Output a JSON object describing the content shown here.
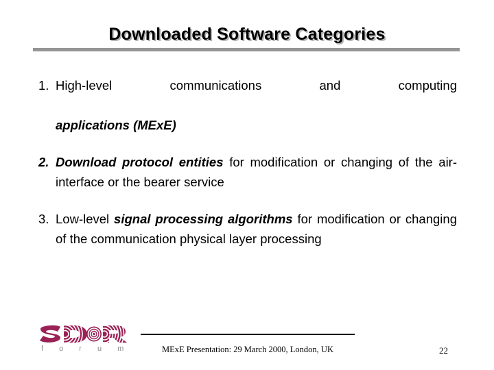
{
  "slide": {
    "title": "Downloaded Software Categories",
    "accent_rule_color": "#959595",
    "logo_color": "#9b2256",
    "text_color": "#000000",
    "background_color": "#ffffff"
  },
  "body": {
    "items": [
      {
        "number": "1.",
        "number_style": "regular",
        "line1_regular": "High-level communications and computing",
        "line2_bold_italic": "applications (MExE)"
      },
      {
        "number": "2.",
        "number_style": "bold-italic",
        "lead_bold_italic": "Download protocol entities",
        "rest_regular": " for modification or changing of the air-interface or the bearer service"
      },
      {
        "number": "3.",
        "number_style": "regular",
        "lead_regular": "Low-level ",
        "mid_bold_italic": "signal processing algorithms",
        "rest_regular": " for modification or changing of the communication physical layer processing"
      }
    ]
  },
  "footer": {
    "logo_mark_text": "SDR",
    "logo_sub_text": "f o r u m",
    "caption": "MExE Presentation: 29 March 2000, London, UK",
    "page_number": "22"
  }
}
